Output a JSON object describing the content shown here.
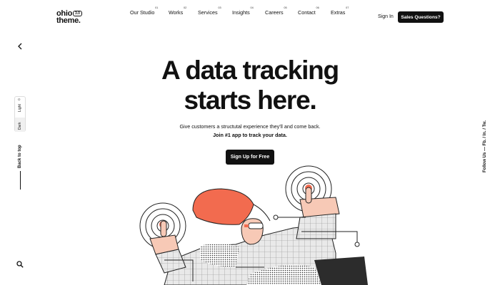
{
  "brand": {
    "line1": "ohio",
    "line2": "theme.",
    "version": "3.0"
  },
  "nav": [
    {
      "num": "01",
      "label": "Our Studio"
    },
    {
      "num": "02",
      "label": "Works"
    },
    {
      "num": "03",
      "label": "Services"
    },
    {
      "num": "04",
      "label": "Insights"
    },
    {
      "num": "05",
      "label": "Careers"
    },
    {
      "num": "06",
      "label": "Contact"
    },
    {
      "num": "07",
      "label": "Extras"
    }
  ],
  "header": {
    "signin": "Sign In",
    "sales": "Sales Questions?"
  },
  "sidebar": {
    "light": "Light",
    "dark": "Dark",
    "back_to_top": "Back to top"
  },
  "social": {
    "follow": "Follow Us — Fb. / In. / Tw."
  },
  "hero": {
    "title_line1": "A data tracking",
    "title_line2": "starts here.",
    "subtitle": "Give customers a structutal experience they'll and come back.",
    "subtitle_bold": "Join #1 app to track your data.",
    "cta": "Sign Up for Free"
  },
  "icons": {
    "back": "chevron-left-icon",
    "sun": "sun-icon",
    "search": "search-icon"
  },
  "colors": {
    "accent": "#f26b4f",
    "dark": "#111111",
    "skin": "#f7c9b6"
  }
}
